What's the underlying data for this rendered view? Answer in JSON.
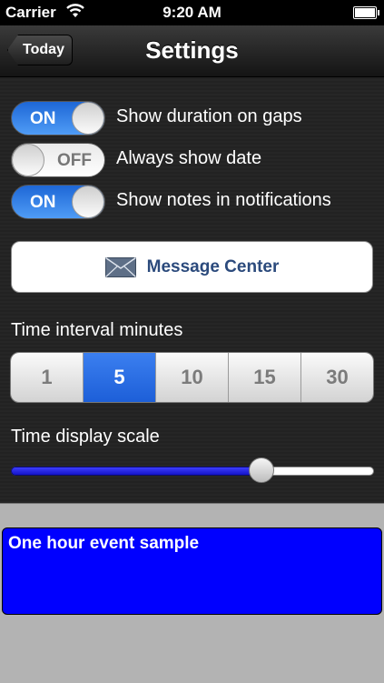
{
  "status_bar": {
    "carrier": "Carrier",
    "time": "9:20 AM",
    "wifi_icon": "wifi-icon",
    "battery_icon": "battery-icon"
  },
  "nav": {
    "back_label": "Today",
    "title": "Settings"
  },
  "toggles": [
    {
      "state_text": "ON",
      "on": true,
      "label": "Show duration on gaps"
    },
    {
      "state_text": "OFF",
      "on": false,
      "label": "Always show date"
    },
    {
      "state_text": "ON",
      "on": true,
      "label": "Show notes in notifications"
    }
  ],
  "message_center": {
    "label": "Message Center",
    "icon": "envelope-icon"
  },
  "time_interval": {
    "label": "Time interval minutes",
    "options": [
      "1",
      "5",
      "10",
      "15",
      "30"
    ],
    "selected": "5"
  },
  "time_scale": {
    "label": "Time display scale",
    "value_fraction": 0.69
  },
  "event_sample": {
    "title": "One hour event sample",
    "color": "#0000FF"
  },
  "colors": {
    "toggle_on": "#2F7DEB",
    "segment_selected": "#2A6BE2",
    "slider_fill": "#2A2AE6",
    "message_text": "#2B4A7C"
  }
}
